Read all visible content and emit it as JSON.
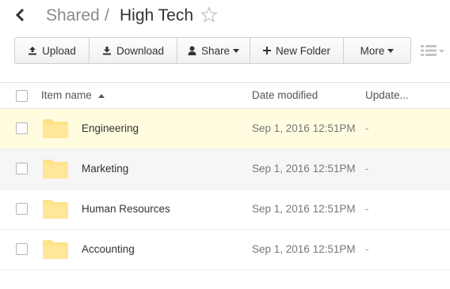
{
  "breadcrumb": {
    "parent": "Shared",
    "separator": "/",
    "current": "High Tech"
  },
  "toolbar": {
    "upload": "Upload",
    "download": "Download",
    "share": "Share",
    "new_folder": "New Folder",
    "more": "More"
  },
  "table": {
    "columns": {
      "name": "Item name",
      "date": "Date modified",
      "updated": "Update..."
    },
    "rows": [
      {
        "name": "Engineering",
        "date": "Sep 1, 2016 12:51PM",
        "updated": "-"
      },
      {
        "name": "Marketing",
        "date": "Sep 1, 2016 12:51PM",
        "updated": "-"
      },
      {
        "name": "Human Resources",
        "date": "Sep 1, 2016 12:51PM",
        "updated": "-"
      },
      {
        "name": "Accounting",
        "date": "Sep 1, 2016 12:51PM",
        "updated": "-"
      }
    ]
  },
  "colors": {
    "selected_row": "#fffce0",
    "alt_row": "#f6f6f6",
    "folder": "#ffe38a"
  }
}
